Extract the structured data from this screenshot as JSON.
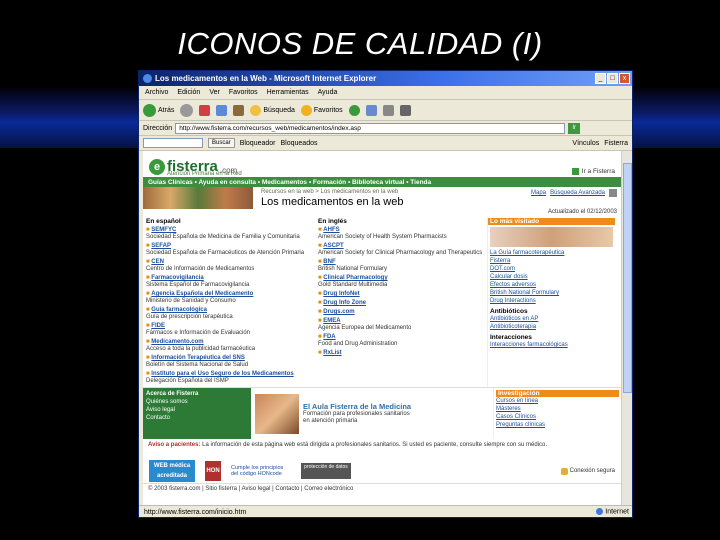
{
  "slide": {
    "title": "ICONOS DE CALIDAD (I)"
  },
  "window": {
    "title": "Los medicamentos en la Web - Microsoft Internet Explorer",
    "controls": [
      "_",
      "□",
      "x"
    ]
  },
  "menu": [
    "Archivo",
    "Edición",
    "Ver",
    "Favoritos",
    "Herramientas",
    "Ayuda"
  ],
  "toolbar": {
    "back": "Atrás",
    "search": "Búsqueda",
    "favorites": "Favoritos"
  },
  "address": {
    "label": "Dirección",
    "url": "http://www.fisterra.com/recursos_web/medicamentos/index.asp",
    "go": "Ir",
    "links": "Vínculos"
  },
  "links_bar": {
    "search_placeholder": "",
    "search_btn": "Buscar",
    "item1": "Bloqueador",
    "item2": "Bloqueados",
    "right": "Fisterra"
  },
  "site": {
    "logo_word": "fisterra",
    "logo_com": ".com",
    "tagline": "Atención Primaria en la Red",
    "head_right": "Ir a Fisterra",
    "nav": "Guías Clínicas • Ayuda en consulta • Medicamentos • Formación • Biblioteca virtual • Tienda",
    "crumb": "Recursos en la web > Los medicamentos en la web",
    "heading": "Los medicamentos en la web",
    "search_map": "Mapa",
    "search_adv": "Búsqueda Avanzada",
    "updated": "Actualizado el 02/12/2003"
  },
  "col_es": {
    "heading": "En español",
    "items": [
      {
        "name": "SEMFYC",
        "desc": "Sociedad Española de Medicina de Familia y Comunitaria"
      },
      {
        "name": "SEFAP",
        "desc": "Sociedad Española de Farmacéuticos de Atención Primaria"
      },
      {
        "name": "CEN",
        "desc": "Centro de Información de Medicamentos"
      },
      {
        "name": "Farmacovigilancia",
        "desc": "Sistema Español de Farmacovigilancia"
      },
      {
        "name": "Agencia Española del Medicamento",
        "desc": "Ministerio de Sanidad y Consumo"
      },
      {
        "name": "Guía farmacológica",
        "desc": "Guía de prescripción terapéutica"
      },
      {
        "name": "FIDE",
        "desc": "Fármacos e Información de Evaluación"
      },
      {
        "name": "Medicamento.com",
        "desc": "Acceso a toda la publicidad farmacéutica"
      },
      {
        "name": "Información Terapéutica del SNS",
        "desc": "Boletín del Sistema Nacional de Salud"
      },
      {
        "name": "Instituto para el Uso Seguro de los Medicamentos",
        "desc": "Delegación Española del ISMP"
      }
    ]
  },
  "col_en": {
    "heading": "En inglés",
    "items": [
      {
        "name": "AHFS",
        "desc": "American Society of Health System Pharmacists"
      },
      {
        "name": "ASCPT",
        "desc": "American Society for Clinical Pharmacology and Therapeutics"
      },
      {
        "name": "BNF",
        "desc": "British National Formulary"
      },
      {
        "name": "Clinical Pharmacology",
        "desc": "Gold Standard Multimedia"
      },
      {
        "name": "Drug InfoNet",
        "desc": ""
      },
      {
        "name": "Drug Info Zone",
        "desc": ""
      },
      {
        "name": "Drugs.com",
        "desc": ""
      },
      {
        "name": "EMEA",
        "desc": "Agencia Europea del Medicamento"
      },
      {
        "name": "FDA",
        "desc": "Food and Drug Administration"
      },
      {
        "name": "RxList",
        "desc": ""
      }
    ]
  },
  "side": {
    "heading": "Lo más visitado",
    "items": [
      "La Guía farmacoterapéutica",
      "Fisterra",
      "DOT.com",
      "Calcular dosis",
      "Efectos adversos",
      "British National Formulary",
      "Drug Interactions"
    ],
    "section2": "Antibióticos",
    "items2": [
      "Antibióticos en AP",
      "Antibioticoterapia"
    ],
    "section3": "Interacciones",
    "items3": [
      "Interacciones farmacológicas"
    ]
  },
  "acerca": {
    "heading": "Acerca de Fisterra",
    "items": [
      "Quiénes somos",
      "Aviso legal",
      "Contacto"
    ]
  },
  "promo": {
    "heading": "El Aula Fisterra de la Medicina",
    "text": "Formación para profesionales sanitarios en atención primaria"
  },
  "investig": {
    "heading": "Investigación",
    "items": [
      "Cursos en línea",
      "Másteres",
      "Casos Clínicos",
      "Preguntas clínicas"
    ]
  },
  "aviso": {
    "label": "Aviso a pacientes:",
    "text": "La información de esta página web está dirigida a profesionales sanitarios. Si usted es paciente, consulte siempre con su médico."
  },
  "badges": {
    "webmed": "WEB médica acreditada",
    "hon": "HON code",
    "hon_text": "Cumple los principios del código HONcode",
    "pm": "protección de datos",
    "secure": "Conexión segura"
  },
  "footer": "© 2003 fisterra.com | Sitio fisterra | Aviso legal | Contacto | Correo electrónico",
  "status": {
    "left": "http://www.fisterra.com/inicio.htm",
    "right": "Internet"
  }
}
